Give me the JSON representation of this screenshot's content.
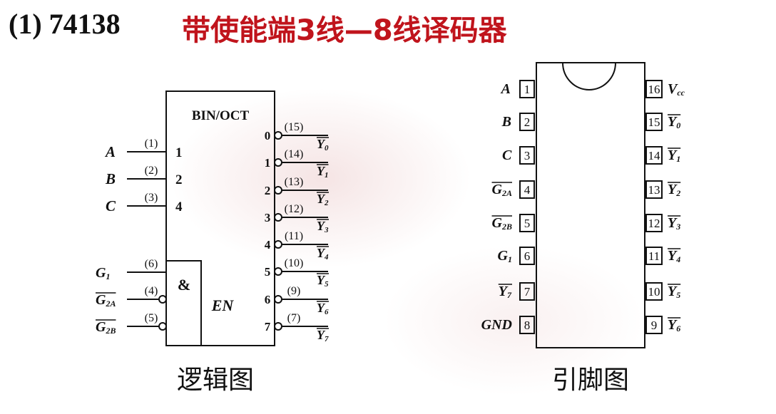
{
  "title": {
    "number": "(1) 74138",
    "text": "带使能端3线—8线译码器"
  },
  "logic": {
    "block_label": "BIN/OCT",
    "enable_gate": "&",
    "enable_label": "EN",
    "caption": "逻辑图",
    "inputs": [
      {
        "name": "A",
        "pin": "(1)",
        "code": "1"
      },
      {
        "name": "B",
        "pin": "(2)",
        "code": "2"
      },
      {
        "name": "C",
        "pin": "(3)",
        "code": "4"
      }
    ],
    "enables": [
      {
        "base": "G",
        "sub": "1",
        "pin": "(6)",
        "active_low": false
      },
      {
        "base": "G",
        "sub": "2A",
        "pin": "(4)",
        "active_low": true
      },
      {
        "base": "G",
        "sub": "2B",
        "pin": "(5)",
        "active_low": true
      }
    ],
    "outputs": [
      {
        "index": "0",
        "pin": "(15)",
        "base": "Y",
        "sub": "0"
      },
      {
        "index": "1",
        "pin": "(14)",
        "base": "Y",
        "sub": "1"
      },
      {
        "index": "2",
        "pin": "(13)",
        "base": "Y",
        "sub": "2"
      },
      {
        "index": "3",
        "pin": "(12)",
        "base": "Y",
        "sub": "3"
      },
      {
        "index": "4",
        "pin": "(11)",
        "base": "Y",
        "sub": "4"
      },
      {
        "index": "5",
        "pin": "(10)",
        "base": "Y",
        "sub": "5"
      },
      {
        "index": "6",
        "pin": "(9)",
        "base": "Y",
        "sub": "6"
      },
      {
        "index": "7",
        "pin": "(7)",
        "base": "Y",
        "sub": "7"
      }
    ]
  },
  "pinout": {
    "caption": "引脚图",
    "left": [
      {
        "num": "1",
        "base": "A",
        "sub": "",
        "overline": false
      },
      {
        "num": "2",
        "base": "B",
        "sub": "",
        "overline": false
      },
      {
        "num": "3",
        "base": "C",
        "sub": "",
        "overline": false
      },
      {
        "num": "4",
        "base": "G",
        "sub": "2A",
        "overline": true
      },
      {
        "num": "5",
        "base": "G",
        "sub": "2B",
        "overline": true
      },
      {
        "num": "6",
        "base": "G",
        "sub": "1",
        "overline": false
      },
      {
        "num": "7",
        "base": "Y",
        "sub": "7",
        "overline": true
      },
      {
        "num": "8",
        "base": "GND",
        "sub": "",
        "overline": false
      }
    ],
    "right": [
      {
        "num": "16",
        "base": "V",
        "sub": "cc",
        "overline": false
      },
      {
        "num": "15",
        "base": "Y",
        "sub": "0",
        "overline": true
      },
      {
        "num": "14",
        "base": "Y",
        "sub": "1",
        "overline": true
      },
      {
        "num": "13",
        "base": "Y",
        "sub": "2",
        "overline": true
      },
      {
        "num": "12",
        "base": "Y",
        "sub": "3",
        "overline": true
      },
      {
        "num": "11",
        "base": "Y",
        "sub": "4",
        "overline": true
      },
      {
        "num": "10",
        "base": "Y",
        "sub": "5",
        "overline": true
      },
      {
        "num": "9",
        "base": "Y",
        "sub": "6",
        "overline": true
      }
    ]
  }
}
